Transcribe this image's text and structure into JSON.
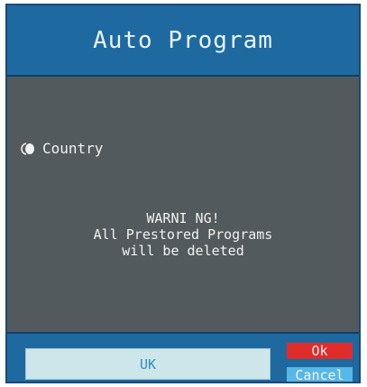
{
  "dialog": {
    "title": "Auto Program"
  },
  "country": {
    "label": "Country",
    "icon": "radio-bullet-icon",
    "selected_value": "UK"
  },
  "warning": {
    "line1": "WARNI NG!",
    "line2": "All Prestored Programs",
    "line3": "will be deleted"
  },
  "buttons": {
    "ok_label": "Ok",
    "cancel_label": "Cancel"
  },
  "colors": {
    "header_blue": "#1e6aa0",
    "body_gray": "#525a5e",
    "ok_red": "#e12c2c",
    "cancel_blue": "#57b7e6",
    "select_bg": "#cde6ea",
    "select_text": "#2f8fc2"
  }
}
